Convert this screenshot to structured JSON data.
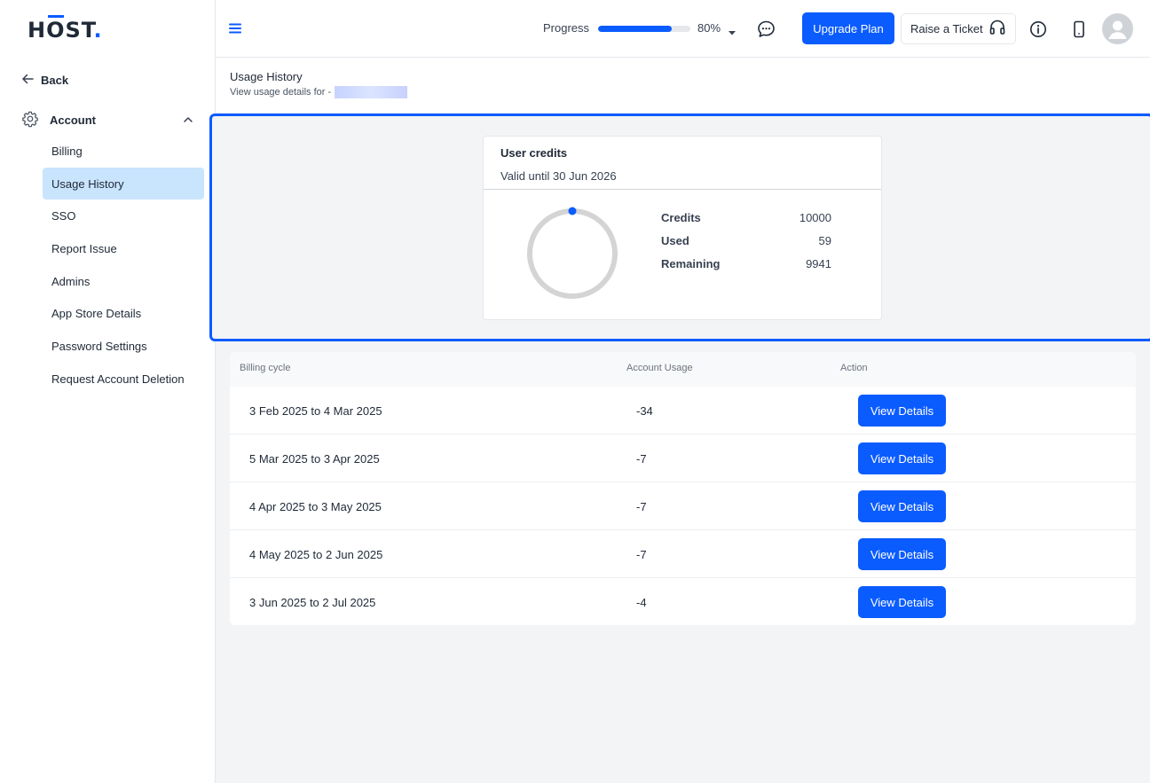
{
  "brand": {
    "logo_h": "H",
    "logo_o": "O",
    "logo_st": "ST",
    "logo_dot": "."
  },
  "sidebar": {
    "back_label": "Back",
    "section_label": "Account",
    "items": [
      {
        "label": "Billing"
      },
      {
        "label": "Usage History",
        "active": true
      },
      {
        "label": "SSO"
      },
      {
        "label": "Report Issue"
      },
      {
        "label": "Admins"
      },
      {
        "label": "App Store Details"
      },
      {
        "label": "Password Settings"
      },
      {
        "label": "Request Account Deletion"
      }
    ]
  },
  "header": {
    "progress_label": "Progress",
    "progress_value": 0.8,
    "progress_text": "80%",
    "upgrade_label": "Upgrade Plan",
    "ticket_label": "Raise a Ticket"
  },
  "page": {
    "title": "Usage History",
    "subtitle": "View usage details for -"
  },
  "credits": {
    "title": "User credits",
    "valid_until": "Valid until 30 Jun 2026",
    "rows": [
      {
        "key": "Credits",
        "value": "10000"
      },
      {
        "key": "Used",
        "value": "59"
      },
      {
        "key": "Remaining",
        "value": "9941"
      }
    ]
  },
  "table": {
    "headers": {
      "cycle": "Billing cycle",
      "usage": "Account Usage",
      "action": "Action"
    },
    "rows": [
      {
        "cycle": "3 Feb 2025 to 4 Mar 2025",
        "usage": "-34",
        "action": "View Details"
      },
      {
        "cycle": "5 Mar 2025 to 3 Apr 2025",
        "usage": "-7",
        "action": "View Details"
      },
      {
        "cycle": "4 Apr 2025 to 3 May 2025",
        "usage": "-7",
        "action": "View Details"
      },
      {
        "cycle": "4 May 2025 to 2 Jun 2025",
        "usage": "-7",
        "action": "View Details"
      },
      {
        "cycle": "3 Jun 2025 to 2 Jul 2025",
        "usage": "-4",
        "action": "View Details"
      }
    ]
  },
  "colors": {
    "accent": "#0b5cff",
    "active_nav": "#c9e4fd",
    "donut_track": "#d4d4d4"
  },
  "icons": [
    "hamburger-icon",
    "chat-icon",
    "headset-icon",
    "info-icon",
    "phone-icon",
    "gear-icon",
    "back-arrow-icon",
    "chevron-up-icon",
    "caret-down-icon",
    "user-avatar-icon"
  ]
}
